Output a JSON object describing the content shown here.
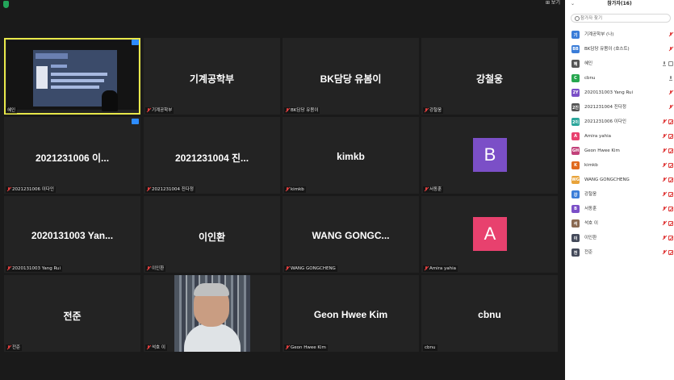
{
  "topbar": {
    "view_label": "⊞ 보기"
  },
  "tiles": [
    {
      "name": "",
      "tag": "혜인",
      "muted": false,
      "kind": "screen"
    },
    {
      "name": "기계공학부",
      "tag": "기계공학부",
      "muted": true
    },
    {
      "name": "BK담당 유봄이",
      "tag": "BK담당 유봄이",
      "muted": true
    },
    {
      "name": "강철웅",
      "tag": "강철웅",
      "muted": true
    },
    {
      "name": "2021231006 이...",
      "tag": "2021231006 이다인",
      "muted": true
    },
    {
      "name": "2021231004 진...",
      "tag": "2021231004 진다정",
      "muted": true
    },
    {
      "name": "kimkb",
      "tag": "kimkb",
      "muted": true
    },
    {
      "name": "",
      "tag": "서동훈",
      "muted": true,
      "avatar": "B",
      "avatar_color": "#7b4fc7"
    },
    {
      "name": "2020131003  Yan...",
      "tag": "2020131003 Yang Rui",
      "muted": true
    },
    {
      "name": "이인환",
      "tag": "이인환",
      "muted": true
    },
    {
      "name": "WANG  GONGC...",
      "tag": "WANG GONGCHENG",
      "muted": true
    },
    {
      "name": "",
      "tag": "Amira yahia",
      "muted": true,
      "avatar": "A",
      "avatar_color": "#e8416e"
    },
    {
      "name": "전준",
      "tag": "전준",
      "muted": true
    },
    {
      "name": "",
      "tag": "석호 이",
      "muted": true,
      "kind": "photo"
    },
    {
      "name": "Geon Hwee Kim",
      "tag": "Geon Hwee Kim",
      "muted": true
    },
    {
      "name": "cbnu",
      "tag": "cbnu",
      "muted": false
    }
  ],
  "sidebar": {
    "title": "참가자(16)",
    "search_placeholder": "참가자 찾기",
    "participants": [
      {
        "initial": "기",
        "name": "기계공학부 (나)",
        "color": "#3b7dd8",
        "mic": "red",
        "cam": ""
      },
      {
        "initial": "BB",
        "name": "BK담당 유봄이 (호스트)",
        "color": "#3b7dd8",
        "mic": "red",
        "cam": ""
      },
      {
        "initial": "혜",
        "name": "혜인",
        "color": "#555555",
        "mic": "gray",
        "cam": "gray"
      },
      {
        "initial": "C",
        "name": "cbnu",
        "color": "#27a74f",
        "mic": "gray",
        "cam": ""
      },
      {
        "initial": "2Y",
        "name": "2020131003 Yang Rui",
        "color": "#7b4fc7",
        "mic": "red",
        "cam": ""
      },
      {
        "initial": "2진",
        "name": "2021231004 진다정",
        "color": "#555555",
        "mic": "red",
        "cam": ""
      },
      {
        "initial": "2이",
        "name": "2021231006 이다인",
        "color": "#2aa59a",
        "mic": "red",
        "cam": "red"
      },
      {
        "initial": "A",
        "name": "Amira yahia",
        "color": "#e8416e",
        "mic": "red",
        "cam": "red"
      },
      {
        "initial": "GH",
        "name": "Geon Hwee Kim",
        "color": "#c2417a",
        "mic": "red",
        "cam": "red"
      },
      {
        "initial": "K",
        "name": "kimkb",
        "color": "#e06a1f",
        "mic": "red",
        "cam": "red"
      },
      {
        "initial": "WG",
        "name": "WANG GONGCHENG",
        "color": "#e8a33a",
        "mic": "red",
        "cam": "red"
      },
      {
        "initial": "강",
        "name": "강철웅",
        "color": "#3b7dd8",
        "mic": "red",
        "cam": "red"
      },
      {
        "initial": "B",
        "name": "서동훈",
        "color": "#7b4fc7",
        "mic": "red",
        "cam": "red"
      },
      {
        "initial": "석",
        "name": "석호 이",
        "color": "#8a6a52",
        "mic": "red",
        "cam": "red"
      },
      {
        "initial": "이",
        "name": "이인환",
        "color": "#444a5a",
        "mic": "red",
        "cam": "red"
      },
      {
        "initial": "전",
        "name": "전준",
        "color": "#444a5a",
        "mic": "red",
        "cam": "red"
      }
    ]
  }
}
